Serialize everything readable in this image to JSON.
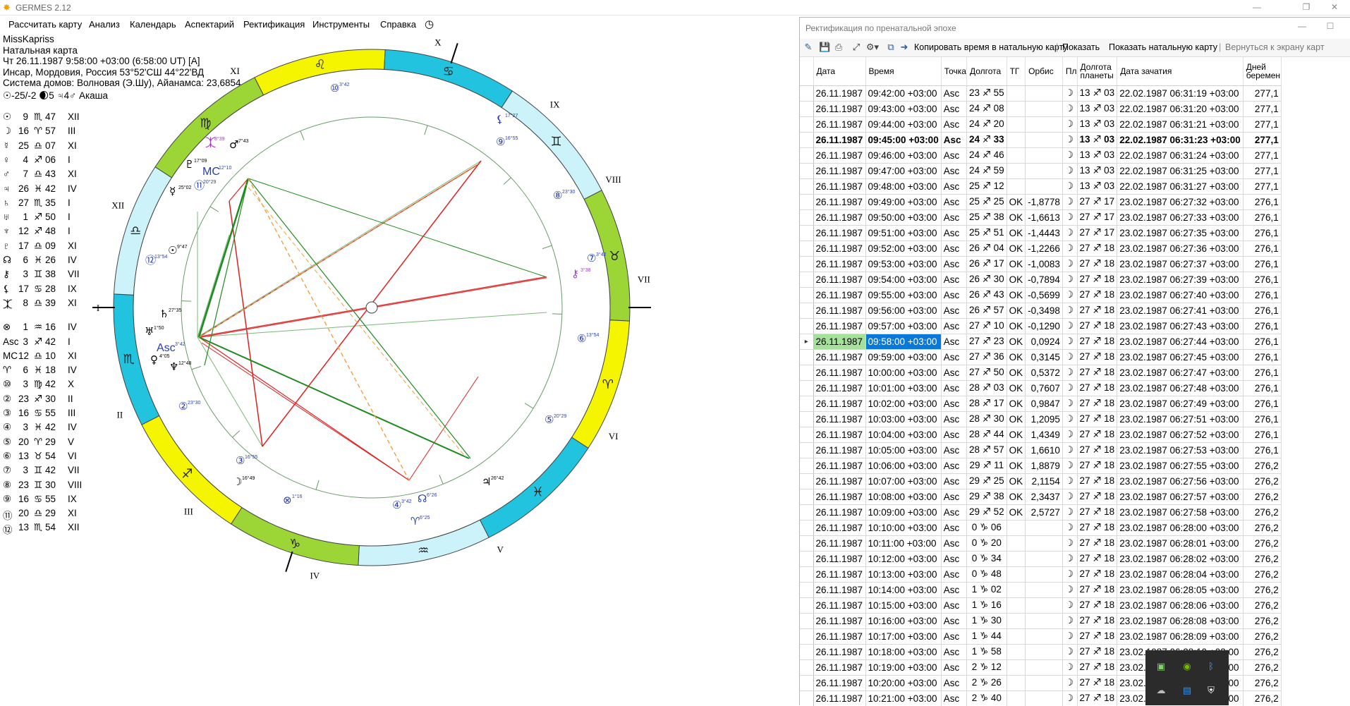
{
  "app": {
    "title": "GERMES 2.12"
  },
  "menu": [
    "Рассчитать карту",
    "Анализ",
    "Календарь",
    "Аспектарий",
    "Ректификация",
    "Инструменты",
    "Справка"
  ],
  "info": {
    "name": "MissKapriss",
    "chart_type": "Натальная карта",
    "datetime": "Чт 26.11.1987 9:58:00 +03:00 (6:58:00 UT) [A]",
    "place": "Инсар, Мордовия, Россия 53°52'СШ 44°22'ВД",
    "houses": "Система домов: Волновая (Э.Шу), Айанамса: 23,6854",
    "extra": "☉-25/-2 🌒5 ♃4♂ Акаша"
  },
  "planets": [
    {
      "g": "☉",
      "deg": "9",
      "sign": "♏",
      "min": "47",
      "house": "XII"
    },
    {
      "g": "☽",
      "deg": "16",
      "sign": "♈",
      "min": "57",
      "house": "III"
    },
    {
      "g": "☿",
      "deg": "25",
      "sign": "♎",
      "min": "07",
      "house": "XI"
    },
    {
      "g": "♀",
      "deg": "4",
      "sign": "♐",
      "min": "06",
      "house": "I"
    },
    {
      "g": "♂",
      "deg": "7",
      "sign": "♎",
      "min": "43",
      "house": "XI"
    },
    {
      "g": "♃",
      "deg": "26",
      "sign": "♓",
      "min": "42",
      "house": "IV"
    },
    {
      "g": "♄",
      "deg": "27",
      "sign": "♏",
      "min": "35",
      "house": "I"
    },
    {
      "g": "♅",
      "deg": "1",
      "sign": "♐",
      "min": "50",
      "house": "I"
    },
    {
      "g": "♆",
      "deg": "12",
      "sign": "♐",
      "min": "48",
      "house": "I"
    },
    {
      "g": "♇",
      "deg": "17",
      "sign": "♎",
      "min": "09",
      "house": "XI"
    },
    {
      "g": "☊",
      "deg": "6",
      "sign": "♓",
      "min": "26",
      "house": "IV"
    },
    {
      "g": "⚷",
      "deg": "3",
      "sign": "♊",
      "min": "38",
      "house": "VII"
    },
    {
      "g": "⚸",
      "deg": "17",
      "sign": "♋",
      "min": "28",
      "house": "IX"
    },
    {
      "g": "⯰",
      "deg": "8",
      "sign": "♎",
      "min": "39",
      "house": "XI"
    },
    {
      "g": "⊗",
      "deg": "1",
      "sign": "♒",
      "min": "16",
      "house": "IV"
    },
    {
      "g": "Asc",
      "deg": "3",
      "sign": "♐",
      "min": "42",
      "house": "I"
    },
    {
      "g": "MC",
      "deg": "12",
      "sign": "♎",
      "min": "10",
      "house": "XI"
    },
    {
      "g": "♈",
      "deg": "6",
      "sign": "♓",
      "min": "18",
      "house": "IV"
    },
    {
      "g": "⑩",
      "deg": "3",
      "sign": "♍",
      "min": "42",
      "house": "X"
    },
    {
      "g": "②",
      "deg": "23",
      "sign": "♐",
      "min": "30",
      "house": "II"
    },
    {
      "g": "③",
      "deg": "16",
      "sign": "♋",
      "min": "55",
      "house": "III"
    },
    {
      "g": "④",
      "deg": "3",
      "sign": "♓",
      "min": "42",
      "house": "IV"
    },
    {
      "g": "⑤",
      "deg": "20",
      "sign": "♈",
      "min": "29",
      "house": "V"
    },
    {
      "g": "⑥",
      "deg": "13",
      "sign": "♉",
      "min": "54",
      "house": "VI"
    },
    {
      "g": "⑦",
      "deg": "3",
      "sign": "♊",
      "min": "42",
      "house": "VII"
    },
    {
      "g": "⑧",
      "deg": "23",
      "sign": "♊",
      "min": "30",
      "house": "VIII"
    },
    {
      "g": "⑨",
      "deg": "16",
      "sign": "♋",
      "min": "55",
      "house": "IX"
    },
    {
      "g": "⑪",
      "deg": "20",
      "sign": "♎",
      "min": "29",
      "house": "XI"
    },
    {
      "g": "⑫",
      "deg": "13",
      "sign": "♏",
      "min": "54",
      "house": "XII"
    }
  ],
  "wheel": {
    "houses": [
      "I",
      "II",
      "III",
      "IV",
      "V",
      "VI",
      "VII",
      "VIII",
      "IX",
      "X",
      "XI",
      "XII"
    ],
    "asc": {
      "label": "Asc",
      "deg": "3°42"
    },
    "mc": {
      "label": "MC",
      "deg": "12°10"
    },
    "labels": [
      {
        "t": "⑩",
        "d": "3°42",
        "c": "#2a3fb0"
      },
      {
        "t": "⚸",
        "d": "17°27",
        "c": "#2a3fb0"
      },
      {
        "t": "⑨",
        "d": "16°55",
        "c": "#2a3fb0"
      },
      {
        "t": "⑧",
        "d": "23°30",
        "c": "#2a3fb0"
      },
      {
        "t": "⑦",
        "d": "3°42",
        "c": "#2a3fb0"
      },
      {
        "t": "⚷",
        "d": "3°38",
        "c": "#a040c0"
      },
      {
        "t": "⑥",
        "d": "13°54",
        "c": "#2a3fb0"
      },
      {
        "t": "⑤",
        "d": "20°29",
        "c": "#2a3fb0"
      },
      {
        "t": "♃",
        "d": "26°42",
        "c": "#000"
      },
      {
        "t": "☊",
        "d": "6°26",
        "c": "#2a3fb0"
      },
      {
        "t": "④",
        "d": "3°42",
        "c": "#2a3fb0"
      },
      {
        "t": "♈",
        "d": "6°25",
        "c": "#2a3fb0"
      },
      {
        "t": "⊗",
        "d": "1°16",
        "c": "#2a3fb0"
      },
      {
        "t": "☽",
        "d": "16°49",
        "c": "#000"
      },
      {
        "t": "③",
        "d": "16°55",
        "c": "#2a3fb0"
      },
      {
        "t": "②",
        "d": "23°30",
        "c": "#2a3fb0"
      },
      {
        "t": "♆",
        "d": "12°48",
        "c": "#000"
      },
      {
        "t": "♀",
        "d": "4°05",
        "c": "#000"
      },
      {
        "t": "♅",
        "d": "1°50",
        "c": "#000"
      },
      {
        "t": "♄",
        "d": "27°35",
        "c": "#000"
      },
      {
        "t": "☉",
        "d": "9°47",
        "c": "#000"
      },
      {
        "t": "⑫",
        "d": "13°54",
        "c": "#2a3fb0"
      },
      {
        "t": "⑪",
        "d": "20°29",
        "c": "#2a3fb0"
      },
      {
        "t": "☿",
        "d": "25°02",
        "c": "#000"
      },
      {
        "t": "♇",
        "d": "17°09",
        "c": "#000"
      },
      {
        "t": "♂",
        "d": "7°43",
        "c": "#000"
      },
      {
        "t": "⯰",
        "d": "8°39",
        "c": "#a040c0"
      }
    ]
  },
  "rect": {
    "title": "Ректификация по пренатальной эпохе",
    "toolbar": {
      "copy": "Копировать время в натальную карту",
      "show": "Показать",
      "show_natal": "Показать натальную карту",
      "back": "Вернуться к экрану карт"
    },
    "columns": [
      "Дата",
      "Время",
      "Точка",
      "Долгота",
      "ТГ",
      "Орбис",
      "Пл",
      "Долгота планеты",
      "Дата зачатия",
      "Дней беремен"
    ],
    "rows": [
      [
        "26.11.1987",
        "09:42:00 +03:00",
        "Asc",
        "23 ♐ 55",
        "",
        "",
        "☽",
        "13 ♐ 03",
        "22.02.1987 06:31:19 +03:00",
        "277,1"
      ],
      [
        "26.11.1987",
        "09:43:00 +03:00",
        "Asc",
        "24 ♐ 08",
        "",
        "",
        "☽",
        "13 ♐ 03",
        "22.02.1987 06:31:20 +03:00",
        "277,1"
      ],
      [
        "26.11.1987",
        "09:44:00 +03:00",
        "Asc",
        "24 ♐ 20",
        "",
        "",
        "☽",
        "13 ♐ 03",
        "22.02.1987 06:31:21 +03:00",
        "277,1"
      ],
      [
        "26.11.1987",
        "09:45:00 +03:00",
        "Asc",
        "24 ♐ 33",
        "",
        "",
        "☽",
        "13 ♐ 03",
        "22.02.1987 06:31:23 +03:00",
        "277,1"
      ],
      [
        "26.11.1987",
        "09:46:00 +03:00",
        "Asc",
        "24 ♐ 46",
        "",
        "",
        "☽",
        "13 ♐ 03",
        "22.02.1987 06:31:24 +03:00",
        "277,1"
      ],
      [
        "26.11.1987",
        "09:47:00 +03:00",
        "Asc",
        "24 ♐ 59",
        "",
        "",
        "☽",
        "13 ♐ 03",
        "22.02.1987 06:31:25 +03:00",
        "277,1"
      ],
      [
        "26.11.1987",
        "09:48:00 +03:00",
        "Asc",
        "25 ♐ 12",
        "",
        "",
        "☽",
        "13 ♐ 03",
        "22.02.1987 06:31:27 +03:00",
        "277,1"
      ],
      [
        "26.11.1987",
        "09:49:00 +03:00",
        "Asc",
        "25 ♐ 25",
        "OK",
        "-1,8778",
        "☽",
        "27 ♐ 17",
        "23.02.1987 06:27:32 +03:00",
        "276,1"
      ],
      [
        "26.11.1987",
        "09:50:00 +03:00",
        "Asc",
        "25 ♐ 38",
        "OK",
        "-1,6613",
        "☽",
        "27 ♐ 17",
        "23.02.1987 06:27:33 +03:00",
        "276,1"
      ],
      [
        "26.11.1987",
        "09:51:00 +03:00",
        "Asc",
        "25 ♐ 51",
        "OK",
        "-1,4443",
        "☽",
        "27 ♐ 17",
        "23.02.1987 06:27:35 +03:00",
        "276,1"
      ],
      [
        "26.11.1987",
        "09:52:00 +03:00",
        "Asc",
        "26 ♐ 04",
        "OK",
        "-1,2266",
        "☽",
        "27 ♐ 18",
        "23.02.1987 06:27:36 +03:00",
        "276,1"
      ],
      [
        "26.11.1987",
        "09:53:00 +03:00",
        "Asc",
        "26 ♐ 17",
        "OK",
        "-1,0083",
        "☽",
        "27 ♐ 18",
        "23.02.1987 06:27:37 +03:00",
        "276,1"
      ],
      [
        "26.11.1987",
        "09:54:00 +03:00",
        "Asc",
        "26 ♐ 30",
        "OK",
        "-0,7894",
        "☽",
        "27 ♐ 18",
        "23.02.1987 06:27:39 +03:00",
        "276,1"
      ],
      [
        "26.11.1987",
        "09:55:00 +03:00",
        "Asc",
        "26 ♐ 43",
        "OK",
        "-0,5699",
        "☽",
        "27 ♐ 18",
        "23.02.1987 06:27:40 +03:00",
        "276,1"
      ],
      [
        "26.11.1987",
        "09:56:00 +03:00",
        "Asc",
        "26 ♐ 57",
        "OK",
        "-0,3498",
        "☽",
        "27 ♐ 18",
        "23.02.1987 06:27:41 +03:00",
        "276,1"
      ],
      [
        "26.11.1987",
        "09:57:00 +03:00",
        "Asc",
        "27 ♐ 10",
        "OK",
        "-0,1290",
        "☽",
        "27 ♐ 18",
        "23.02.1987 06:27:43 +03:00",
        "276,1"
      ],
      [
        "26.11.1987",
        "09:58:00 +03:00",
        "Asc",
        "27 ♐ 23",
        "OK",
        "0,0924",
        "☽",
        "27 ♐ 18",
        "23.02.1987 06:27:44 +03:00",
        "276,1"
      ],
      [
        "26.11.1987",
        "09:59:00 +03:00",
        "Asc",
        "27 ♐ 36",
        "OK",
        "0,3145",
        "☽",
        "27 ♐ 18",
        "23.02.1987 06:27:45 +03:00",
        "276,1"
      ],
      [
        "26.11.1987",
        "10:00:00 +03:00",
        "Asc",
        "27 ♐ 50",
        "OK",
        "0,5372",
        "☽",
        "27 ♐ 18",
        "23.02.1987 06:27:47 +03:00",
        "276,1"
      ],
      [
        "26.11.1987",
        "10:01:00 +03:00",
        "Asc",
        "28 ♐ 03",
        "OK",
        "0,7607",
        "☽",
        "27 ♐ 18",
        "23.02.1987 06:27:48 +03:00",
        "276,1"
      ],
      [
        "26.11.1987",
        "10:02:00 +03:00",
        "Asc",
        "28 ♐ 17",
        "OK",
        "0,9847",
        "☽",
        "27 ♐ 18",
        "23.02.1987 06:27:49 +03:00",
        "276,1"
      ],
      [
        "26.11.1987",
        "10:03:00 +03:00",
        "Asc",
        "28 ♐ 30",
        "OK",
        "1,2095",
        "☽",
        "27 ♐ 18",
        "23.02.1987 06:27:51 +03:00",
        "276,1"
      ],
      [
        "26.11.1987",
        "10:04:00 +03:00",
        "Asc",
        "28 ♐ 44",
        "OK",
        "1,4349",
        "☽",
        "27 ♐ 18",
        "23.02.1987 06:27:52 +03:00",
        "276,1"
      ],
      [
        "26.11.1987",
        "10:05:00 +03:00",
        "Asc",
        "28 ♐ 57",
        "OK",
        "1,6610",
        "☽",
        "27 ♐ 18",
        "23.02.1987 06:27:53 +03:00",
        "276,1"
      ],
      [
        "26.11.1987",
        "10:06:00 +03:00",
        "Asc",
        "29 ♐ 11",
        "OK",
        "1,8879",
        "☽",
        "27 ♐ 18",
        "23.02.1987 06:27:55 +03:00",
        "276,2"
      ],
      [
        "26.11.1987",
        "10:07:00 +03:00",
        "Asc",
        "29 ♐ 25",
        "OK",
        "2,1154",
        "☽",
        "27 ♐ 18",
        "23.02.1987 06:27:56 +03:00",
        "276,2"
      ],
      [
        "26.11.1987",
        "10:08:00 +03:00",
        "Asc",
        "29 ♐ 38",
        "OK",
        "2,3437",
        "☽",
        "27 ♐ 18",
        "23.02.1987 06:27:57 +03:00",
        "276,2"
      ],
      [
        "26.11.1987",
        "10:09:00 +03:00",
        "Asc",
        "29 ♐ 52",
        "OK",
        "2,5727",
        "☽",
        "27 ♐ 18",
        "23.02.1987 06:27:58 +03:00",
        "276,2"
      ],
      [
        "26.11.1987",
        "10:10:00 +03:00",
        "Asc",
        "0 ♑ 06",
        "",
        "",
        "☽",
        "27 ♐ 18",
        "23.02.1987 06:28:00 +03:00",
        "276,2"
      ],
      [
        "26.11.1987",
        "10:11:00 +03:00",
        "Asc",
        "0 ♑ 20",
        "",
        "",
        "☽",
        "27 ♐ 18",
        "23.02.1987 06:28:01 +03:00",
        "276,2"
      ],
      [
        "26.11.1987",
        "10:12:00 +03:00",
        "Asc",
        "0 ♑ 34",
        "",
        "",
        "☽",
        "27 ♐ 18",
        "23.02.1987 06:28:02 +03:00",
        "276,2"
      ],
      [
        "26.11.1987",
        "10:13:00 +03:00",
        "Asc",
        "0 ♑ 48",
        "",
        "",
        "☽",
        "27 ♐ 18",
        "23.02.1987 06:28:04 +03:00",
        "276,2"
      ],
      [
        "26.11.1987",
        "10:14:00 +03:00",
        "Asc",
        "1 ♑ 02",
        "",
        "",
        "☽",
        "27 ♐ 18",
        "23.02.1987 06:28:05 +03:00",
        "276,2"
      ],
      [
        "26.11.1987",
        "10:15:00 +03:00",
        "Asc",
        "1 ♑ 16",
        "",
        "",
        "☽",
        "27 ♐ 18",
        "23.02.1987 06:28:06 +03:00",
        "276,2"
      ],
      [
        "26.11.1987",
        "10:16:00 +03:00",
        "Asc",
        "1 ♑ 30",
        "",
        "",
        "☽",
        "27 ♐ 18",
        "23.02.1987 06:28:08 +03:00",
        "276,2"
      ],
      [
        "26.11.1987",
        "10:17:00 +03:00",
        "Asc",
        "1 ♑ 44",
        "",
        "",
        "☽",
        "27 ♐ 18",
        "23.02.1987 06:28:09 +03:00",
        "276,2"
      ],
      [
        "26.11.1987",
        "10:18:00 +03:00",
        "Asc",
        "1 ♑ 58",
        "",
        "",
        "☽",
        "27 ♐ 18",
        "23.02.1987 06:28:10 +03:00",
        "276,2"
      ],
      [
        "26.11.1987",
        "10:19:00 +03:00",
        "Asc",
        "2 ♑ 12",
        "",
        "",
        "☽",
        "27 ♐ 18",
        "23.02.1987 06:28:12 +03:00",
        "276,2"
      ],
      [
        "26.11.1987",
        "10:20:00 +03:00",
        "Asc",
        "2 ♑ 26",
        "",
        "",
        "☽",
        "27 ♐ 18",
        "23.02.1987 06:28:13 +03:00",
        "276,2"
      ],
      [
        "26.11.1987",
        "10:21:00 +03:00",
        "Asc",
        "2 ♑ 40",
        "",
        "",
        "☽",
        "27 ♐ 18",
        "23.02.1987 06:28:14 +03:00",
        "276,2"
      ]
    ],
    "selected_row": 16,
    "bold_row": 3
  },
  "colors": {
    "yellow": "#f5f500",
    "green": "#9bd636",
    "cyan": "#22c3df",
    "lightcyan": "#ccf2fa",
    "aspect_red": "#e02020",
    "aspect_green": "#1f8a1f",
    "aspect_orange": "#f0a040",
    "aspect_lightgreen": "#7ab87a"
  }
}
